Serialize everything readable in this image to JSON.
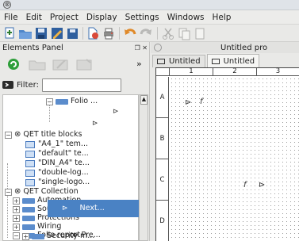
{
  "titlebar": {
    "icon": "app-icon"
  },
  "menubar": [
    "File",
    "Edit",
    "Project",
    "Display",
    "Settings",
    "Windows",
    "Help"
  ],
  "panel": {
    "title": "Elements Panel",
    "controls": "❐ ✕",
    "more": "»",
    "filter_label": "Filter:",
    "filter_value": ""
  },
  "tree": [
    {
      "label": "Folio ...",
      "type": "folder",
      "depth": 4
    },
    {
      "label": "",
      "type": "symbol",
      "depth": 6,
      "symbol": "⊳"
    },
    {
      "label": "",
      "type": "symbol",
      "depth": 5,
      "symbol": "⊳"
    },
    {
      "label": "QET title blocks",
      "type": "gear",
      "depth": 0,
      "expander": "−"
    },
    {
      "label": "\"A4_1\" tem...",
      "type": "doc",
      "depth": 2
    },
    {
      "label": "\"default\" te...",
      "type": "doc",
      "depth": 2
    },
    {
      "label": "\"DIN_A4\" te...",
      "type": "doc",
      "depth": 2
    },
    {
      "label": "\"double-log...",
      "type": "doc",
      "depth": 2
    },
    {
      "label": "\"single-logo...",
      "type": "doc",
      "depth": 2
    },
    {
      "label": "QET Collection",
      "type": "gear",
      "depth": 0,
      "expander": "−"
    },
    {
      "label": "Automation",
      "type": "folder",
      "depth": 1,
      "expander": "+"
    },
    {
      "label": "Sources",
      "type": "folder",
      "depth": 1,
      "expander": "+"
    },
    {
      "label": "Protections",
      "type": "folder",
      "depth": 1,
      "expander": "+"
    },
    {
      "label": "Wiring",
      "type": "folder",
      "depth": 1,
      "expander": "+"
    },
    {
      "label": "Folio report",
      "type": "folder",
      "depth": 1,
      "expander": "−"
    },
    {
      "label": "Pre...",
      "type": "symbol",
      "depth": 4,
      "symbol": "⊳"
    },
    {
      "label": "Next...",
      "type": "symbol",
      "depth": 3,
      "symbol": "⊳",
      "selected": true
    },
    {
      "label": "Security m...",
      "type": "folder",
      "depth": 1,
      "expander": "+"
    }
  ],
  "editor": {
    "title": "Untitled pro",
    "tabs": [
      "Untitled",
      "Untitled"
    ],
    "columns": [
      "1",
      "2",
      "3"
    ],
    "rows": [
      "A",
      "B",
      "C",
      "D"
    ],
    "glyphs": [
      "⊳",
      "f",
      "f",
      "⊳"
    ]
  }
}
